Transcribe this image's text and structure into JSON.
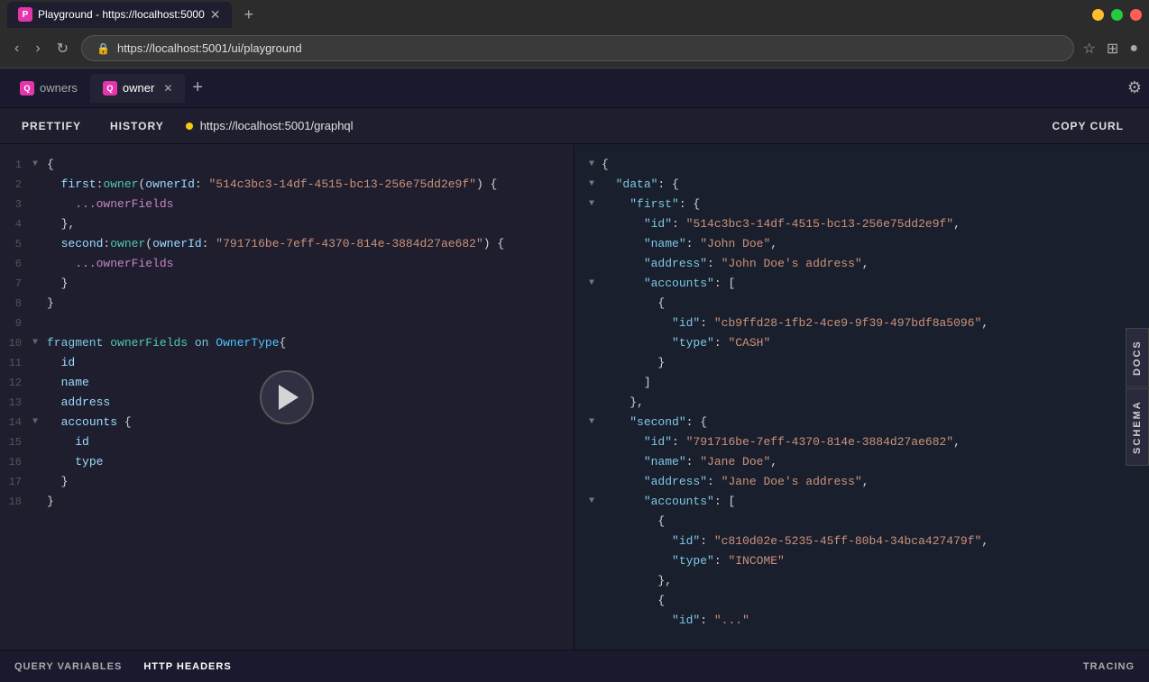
{
  "browser": {
    "title": "Playground - https://localhost:5000",
    "url": "https://localhost:5001/ui/playground",
    "new_tab_label": "+",
    "tab1": {
      "label": "owners",
      "active": false
    },
    "tab2": {
      "label": "owner",
      "active": true
    }
  },
  "toolbar": {
    "prettify": "PRETTIFY",
    "history": "HISTORY",
    "endpoint": "https://localhost:5001/graphql",
    "copy_curl": "COPY CURL"
  },
  "editor": {
    "lines": [
      {
        "num": "1",
        "toggle": "▼",
        "code": "{"
      },
      {
        "num": "2",
        "toggle": " ",
        "code": "  first:owner(ownerId: \"514c3bc3-14df-4515-bc13-256e75dd2e9f\") {"
      },
      {
        "num": "3",
        "toggle": " ",
        "code": "    ...ownerFields"
      },
      {
        "num": "4",
        "toggle": " ",
        "code": "  },"
      },
      {
        "num": "5",
        "toggle": " ",
        "code": "  second:owner(ownerId: \"791716be-7eff-4370-814e-3884d27ae682\") {"
      },
      {
        "num": "6",
        "toggle": " ",
        "code": "    ...ownerFields"
      },
      {
        "num": "7",
        "toggle": " ",
        "code": "  }"
      },
      {
        "num": "8",
        "toggle": " ",
        "code": "}"
      },
      {
        "num": "9",
        "toggle": " ",
        "code": ""
      },
      {
        "num": "10",
        "toggle": "▼",
        "code": "fragment ownerFields on OwnerType{"
      },
      {
        "num": "11",
        "toggle": " ",
        "code": "  id"
      },
      {
        "num": "12",
        "toggle": " ",
        "code": "  name"
      },
      {
        "num": "13",
        "toggle": " ",
        "code": "  address"
      },
      {
        "num": "14",
        "toggle": "▼",
        "code": "  accounts {"
      },
      {
        "num": "15",
        "toggle": " ",
        "code": "    id"
      },
      {
        "num": "16",
        "toggle": " ",
        "code": "    type"
      },
      {
        "num": "17",
        "toggle": " ",
        "code": "  }"
      },
      {
        "num": "18",
        "toggle": " ",
        "code": "}"
      }
    ]
  },
  "response": {
    "lines": [
      {
        "indent": 0,
        "toggle": "▼",
        "content": "{"
      },
      {
        "indent": 1,
        "toggle": "▼",
        "content": "  \"data\": {"
      },
      {
        "indent": 2,
        "toggle": "▼",
        "content": "    \"first\": {"
      },
      {
        "indent": 3,
        "toggle": " ",
        "content": "      \"id\": \"514c3bc3-14df-4515-bc13-256e75dd2e9f\","
      },
      {
        "indent": 3,
        "toggle": " ",
        "content": "      \"name\": \"John Doe\","
      },
      {
        "indent": 3,
        "toggle": " ",
        "content": "      \"address\": \"John Doe's address\","
      },
      {
        "indent": 3,
        "toggle": "▼",
        "content": "      \"accounts\": ["
      },
      {
        "indent": 4,
        "toggle": " ",
        "content": "        {"
      },
      {
        "indent": 5,
        "toggle": " ",
        "content": "          \"id\": \"cb9ffd28-1fb2-4ce9-9f39-497bdf8a5096\","
      },
      {
        "indent": 5,
        "toggle": " ",
        "content": "          \"type\": \"CASH\""
      },
      {
        "indent": 4,
        "toggle": " ",
        "content": "        }"
      },
      {
        "indent": 3,
        "toggle": " ",
        "content": "      ]"
      },
      {
        "indent": 2,
        "toggle": " ",
        "content": "    },"
      },
      {
        "indent": 2,
        "toggle": "▼",
        "content": "    \"second\": {"
      },
      {
        "indent": 3,
        "toggle": " ",
        "content": "      \"id\": \"791716be-7eff-4370-814e-3884d27ae682\","
      },
      {
        "indent": 3,
        "toggle": " ",
        "content": "      \"name\": \"Jane Doe\","
      },
      {
        "indent": 3,
        "toggle": " ",
        "content": "      \"address\": \"Jane Doe's address\","
      },
      {
        "indent": 3,
        "toggle": "▼",
        "content": "      \"accounts\": ["
      },
      {
        "indent": 4,
        "toggle": " ",
        "content": "        {"
      },
      {
        "indent": 5,
        "toggle": " ",
        "content": "          \"id\": \"c810d02e-5235-45ff-80b4-34bca427479f\","
      },
      {
        "indent": 5,
        "toggle": " ",
        "content": "          \"type\": \"INCOME\""
      },
      {
        "indent": 4,
        "toggle": " ",
        "content": "        },"
      },
      {
        "indent": 4,
        "toggle": " ",
        "content": "        {"
      },
      {
        "indent": 5,
        "toggle": " ",
        "content": "          \"id\": \"..."
      }
    ]
  },
  "side_tabs": {
    "docs": "DOCS",
    "schema": "SCHEMA"
  },
  "bottom_bar": {
    "query_variables": "QUERY VARIABLES",
    "http_headers": "HTTP HEADERS",
    "tracing": "TRACING"
  }
}
